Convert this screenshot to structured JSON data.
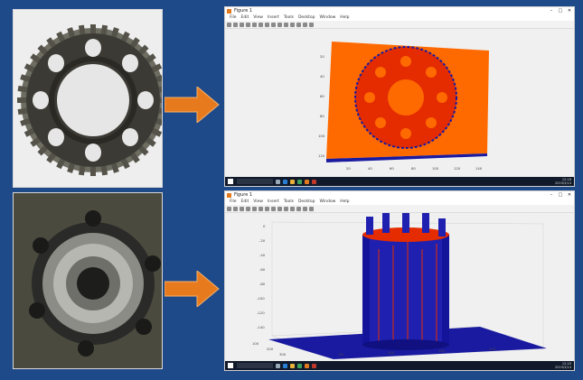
{
  "slide": {
    "bg": "#1f4a8a",
    "arrow_color": "#e87a1e"
  },
  "windows": [
    {
      "title": "Figure 1",
      "menu": [
        "File",
        "Edit",
        "View",
        "Insert",
        "Tools",
        "Desktop",
        "Window",
        "Help"
      ],
      "controls": [
        "–",
        "□",
        "✕"
      ],
      "y_ticks": [
        "20",
        "40",
        "60",
        "80",
        "100",
        "120"
      ],
      "x_ticks": [
        "20",
        "40",
        "60",
        "80",
        "100",
        "120",
        "140"
      ],
      "clock": [
        "12:16",
        "2019/3/14"
      ]
    },
    {
      "title": "Figure 1",
      "menu": [
        "File",
        "Edit",
        "View",
        "Insert",
        "Tools",
        "Desktop",
        "Window",
        "Help"
      ],
      "controls": [
        "–",
        "□",
        "✕"
      ],
      "z_ticks": [
        "0",
        "-20",
        "-40",
        "-60",
        "-80",
        "-100",
        "-120",
        "-140"
      ],
      "x_ticks": [
        "50",
        "100",
        "150",
        "200"
      ],
      "y_ticks": [
        "100",
        "200",
        "300"
      ],
      "clock": [
        "12:20",
        "2019/3/14"
      ]
    }
  ]
}
